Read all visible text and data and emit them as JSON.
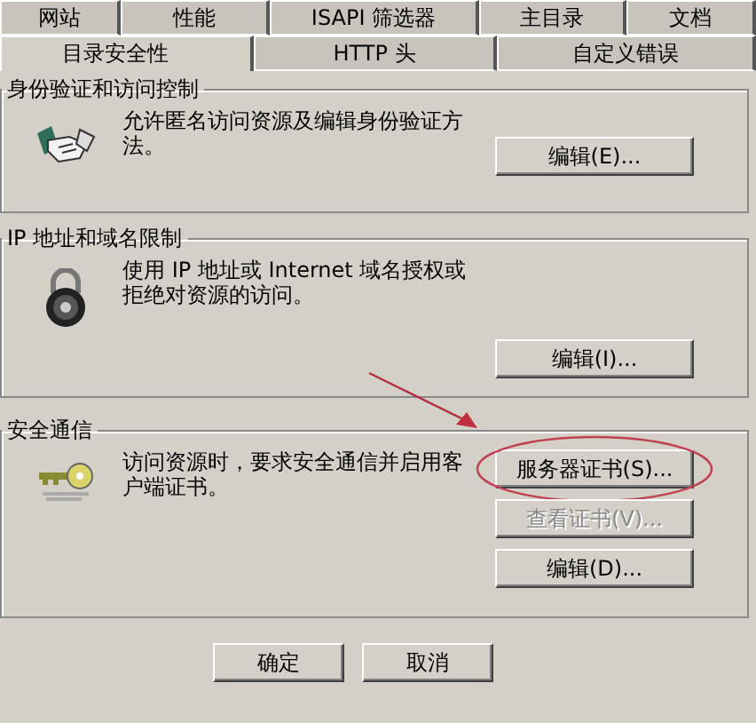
{
  "tab_rows": [
    {
      "tabs": [
        {
          "label": "网站",
          "selected": false
        },
        {
          "label": "性能",
          "selected": false
        },
        {
          "label": "ISAPI 筛选器",
          "selected": false
        },
        {
          "label": "主目录",
          "selected": false
        },
        {
          "label": "文档",
          "selected": false
        }
      ]
    },
    {
      "tabs": [
        {
          "label": "目录安全性",
          "selected": true
        },
        {
          "label": "HTTP 头",
          "selected": false
        },
        {
          "label": "自定义错误",
          "selected": false
        }
      ]
    }
  ],
  "sections": [
    {
      "title": "身份验证和访问控制",
      "kind": "handshake",
      "description": "允许匿名访问资源及编辑身份验证方法。",
      "buttons": [
        {
          "label": "编辑(E)...",
          "disabled": false,
          "annotated": false
        }
      ]
    },
    {
      "title": "IP 地址和域名限制",
      "kind": "lock",
      "description": "使用 IP 地址或 Internet 域名授权或拒绝对资源的访问。",
      "buttons": [
        {
          "label": "编辑(I)...",
          "disabled": false,
          "annotated": false
        }
      ]
    },
    {
      "title": "安全通信",
      "kind": "key",
      "description": "访问资源时，要求安全通信并启用客户端证书。",
      "buttons": [
        {
          "label": "服务器证书(S)...",
          "disabled": false,
          "annotated": true
        },
        {
          "label": "查看证书(V)...",
          "disabled": true,
          "annotated": false
        },
        {
          "label": "编辑(D)...",
          "disabled": false,
          "annotated": false
        }
      ]
    }
  ],
  "footer_buttons": [
    "确定",
    "取消"
  ]
}
